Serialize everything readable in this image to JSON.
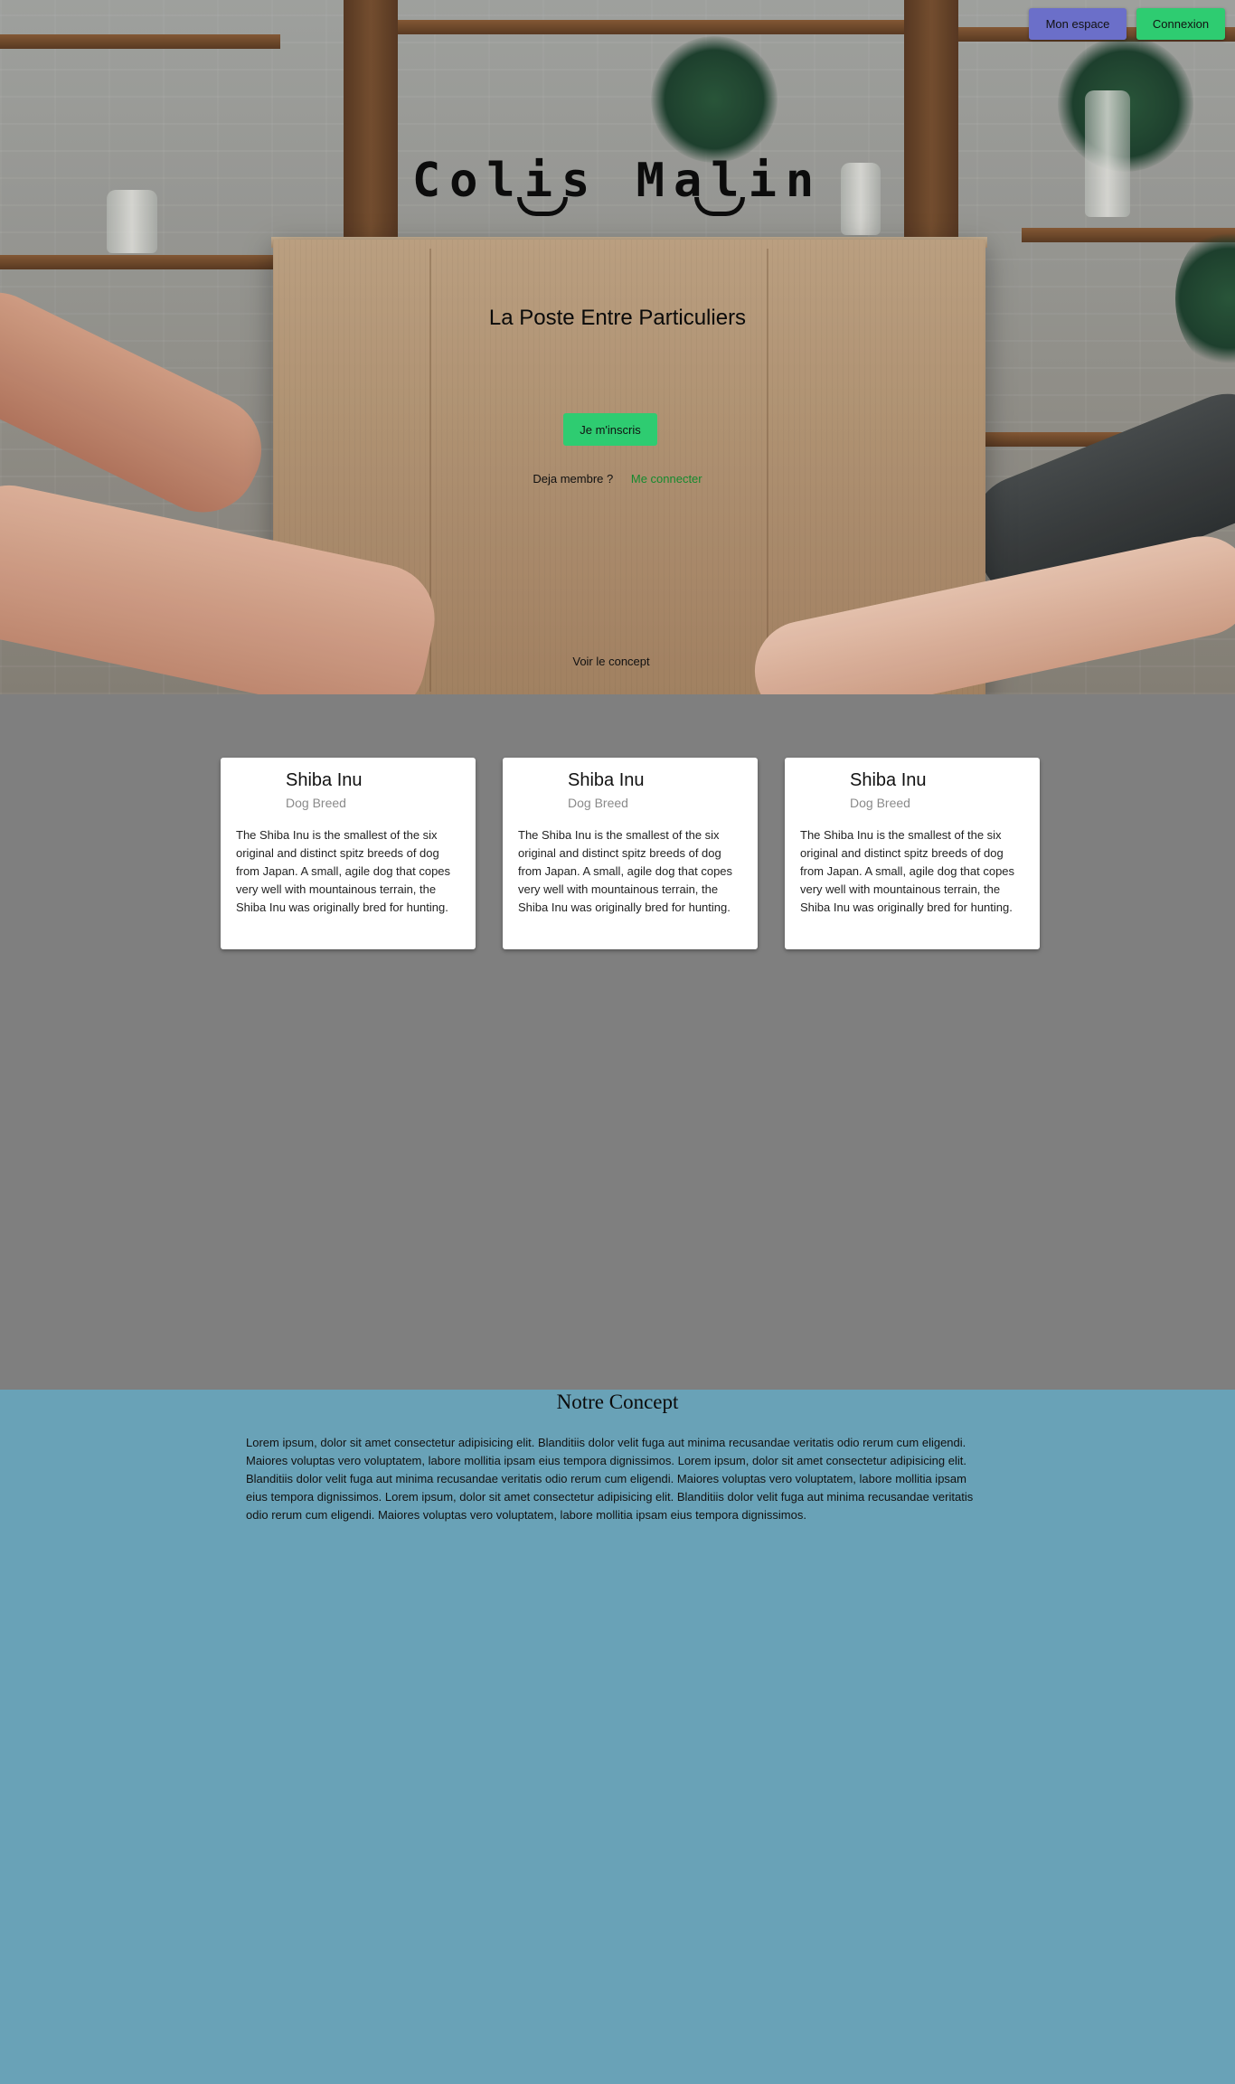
{
  "header": {
    "mon_espace_label": "Mon espace",
    "connexion_label": "Connexion"
  },
  "hero": {
    "logo_text": "Colis Malin",
    "subtitle": "La Poste Entre Particuliers",
    "signup_label": "Je m'inscris",
    "member_prompt": "Deja membre ?",
    "login_link": "Me connecter",
    "concept_link": "Voir le concept"
  },
  "cards": [
    {
      "title": "Shiba Inu",
      "subtitle": "Dog Breed",
      "text": "The Shiba Inu is the smallest of the six original and distinct spitz breeds of dog from Japan. A small, agile dog that copes very well with mountainous terrain, the Shiba Inu was originally bred for hunting."
    },
    {
      "title": "Shiba Inu",
      "subtitle": "Dog Breed",
      "text": "The Shiba Inu is the smallest of the six original and distinct spitz breeds of dog from Japan. A small, agile dog that copes very well with mountainous terrain, the Shiba Inu was originally bred for hunting."
    },
    {
      "title": "Shiba Inu",
      "subtitle": "Dog Breed",
      "text": "The Shiba Inu is the smallest of the six original and distinct spitz breeds of dog from Japan. A small, agile dog that copes very well with mountainous terrain, the Shiba Inu was originally bred for hunting."
    }
  ],
  "concept": {
    "title": "Notre Concept",
    "text": "Lorem ipsum, dolor sit amet consectetur adipisicing elit. Blanditiis dolor velit fuga aut minima recusandae veritatis odio rerum cum eligendi. Maiores voluptas vero voluptatem, labore mollitia ipsam eius tempora dignissimos. Lorem ipsum, dolor sit amet consectetur adipisicing elit. Blanditiis dolor velit fuga aut minima recusandae veritatis odio rerum cum eligendi. Maiores voluptas vero voluptatem, labore mollitia ipsam eius tempora dignissimos. Lorem ipsum, dolor sit amet consectetur adipisicing elit. Blanditiis dolor velit fuga aut minima recusandae veritatis odio rerum cum eligendi. Maiores voluptas vero voluptatem, labore mollitia ipsam eius tempora dignissimos."
  },
  "colors": {
    "primary_green": "#2ecc71",
    "espace_purple": "#6b6fc9",
    "link_green": "#158a2e",
    "cards_section_bg": "#7f7f7f",
    "concept_bg": "#69a2b7"
  }
}
